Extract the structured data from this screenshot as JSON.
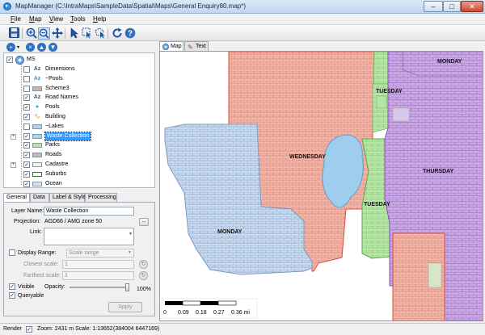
{
  "window": {
    "title": "MapManager (C:\\IntraMaps\\SampleData\\Spatial\\Maps\\General Enquiry80.map*)",
    "minimize": "–",
    "maximize": "□",
    "close": "✕"
  },
  "menu": [
    "File",
    "Map",
    "View",
    "Tools",
    "Help"
  ],
  "toolbar": {
    "icons": [
      "save-icon",
      "zoom-in-icon",
      "zoom-out-icon",
      "pan-icon",
      "select-arrow-icon",
      "select-box-icon",
      "select-polygon-icon",
      "refresh-icon",
      "help-icon"
    ]
  },
  "layer_toolbar": {
    "icons": [
      "add-layer-icon",
      "dropdown-icon",
      "remove-layer-icon",
      "move-up-icon",
      "move-down-icon"
    ]
  },
  "layers": {
    "root": "MS",
    "items": [
      {
        "name": "Dimensions",
        "type": "text",
        "type_glyph": "Az",
        "checked": false,
        "expandable": false,
        "color": "#555555"
      },
      {
        "name": "~Pools",
        "type": "text",
        "type_glyph": "Az",
        "checked": false,
        "expandable": false,
        "color": "#3a9ad9"
      },
      {
        "name": "Scheme3",
        "type": "polygon",
        "type_glyph": "",
        "checked": false,
        "expandable": false,
        "color": "#b9b9b9"
      },
      {
        "name": "Road Names",
        "type": "text",
        "type_glyph": "Az",
        "checked": true,
        "expandable": false,
        "color": "#555555"
      },
      {
        "name": "Pools",
        "type": "point",
        "type_glyph": "●",
        "checked": true,
        "expandable": false,
        "color": "#1fa7c8"
      },
      {
        "name": "Building",
        "type": "line",
        "type_glyph": "∿",
        "checked": true,
        "expandable": false,
        "color": "#e2a93a"
      },
      {
        "name": "~Lakes",
        "type": "polygon",
        "type_glyph": "",
        "checked": false,
        "expandable": false,
        "color": "#a9d4f0"
      },
      {
        "name": "Waste Collection",
        "type": "polygon",
        "type_glyph": "",
        "checked": true,
        "expandable": true,
        "selected": true,
        "color": "#a9d4f0"
      },
      {
        "name": "Parks",
        "type": "polygon",
        "type_glyph": "",
        "checked": true,
        "expandable": false,
        "color": "#b7e6a8"
      },
      {
        "name": "Roads",
        "type": "polygon",
        "type_glyph": "",
        "checked": true,
        "expandable": false,
        "color": "#bcbcbc"
      },
      {
        "name": "Cadastre",
        "type": "polygon",
        "type_glyph": "",
        "checked": true,
        "expandable": true,
        "color": "#f7efdc"
      },
      {
        "name": "Suburbs",
        "type": "polygon",
        "type_glyph": "",
        "checked": true,
        "expandable": false,
        "color": "#ffffff",
        "border": "#2a7a2a"
      },
      {
        "name": "Ocean",
        "type": "polygon",
        "type_glyph": "",
        "checked": true,
        "expandable": false,
        "color": "#cfe8f8"
      }
    ]
  },
  "property_tabs": [
    "General",
    "Data",
    "Label & Style",
    "Processing"
  ],
  "properties": {
    "layer_name_label": "Layer Name:",
    "layer_name_value": "Waste Collection",
    "projection_label": "Projection:",
    "projection_value": "AGD66 / AMG zone 50",
    "projection_button": "...",
    "link_label": "Link:",
    "link_value": "",
    "display_range_label": "Display Range:",
    "display_range_checked": false,
    "display_range_select": "Scale range",
    "closest_scale_label": "Closest scale:",
    "closest_scale_value": "1",
    "farthest_scale_label": "Farthest scale:",
    "farthest_scale_value": "1",
    "visible_label": "Visible",
    "visible_checked": true,
    "opacity_label": "Opacity:",
    "opacity_value": "100%",
    "opacity_fraction": 1.0,
    "queryable_label": "Queryable",
    "queryable_checked": true,
    "apply_label": "Apply"
  },
  "map_tabs": [
    {
      "label": "Map",
      "icon": "globe-icon",
      "active": true
    },
    {
      "label": "Text",
      "icon": "pencil-icon",
      "active": false
    }
  ],
  "map": {
    "regions": [
      "MONDAY",
      "TUESDAY",
      "WEDNESDAY",
      "TUESDAY",
      "THURSDAY",
      "MONDAY"
    ],
    "colors": {
      "monday": "#c9d9ee",
      "tuesday": "#b9e7a9",
      "wednesday": "#f2b5a8",
      "thursday": "#c9a6e4",
      "lake": "#9fcdee",
      "parcel_line_monday": "#7d9bc4",
      "parcel_line_wednesday": "#c97c6c",
      "parcel_line_thursday": "#8c66b2",
      "border_red": "#e0463a"
    },
    "scale_labels": [
      "0",
      "0.09",
      "0.18",
      "0.27",
      "0.36 mi"
    ]
  },
  "status": {
    "render_label": "Render",
    "render_checked": true,
    "zoom": "Zoom: 2431 m",
    "scale": "Scale: 1:13652",
    "coords": "(384004  6447169)"
  }
}
